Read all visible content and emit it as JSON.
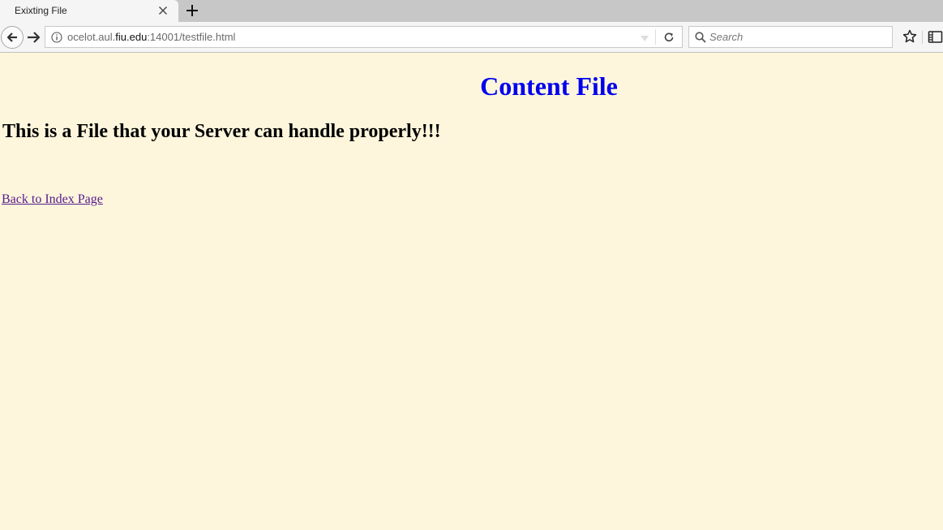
{
  "browser": {
    "tab": {
      "title": "Exixting File",
      "close_icon": "close-icon"
    },
    "new_tab_icon": "plus-icon",
    "nav": {
      "back_icon": "arrow-left-icon",
      "forward_icon": "arrow-right-icon",
      "reload_icon": "reload-icon",
      "info_icon": "info-icon"
    },
    "url": {
      "prefix": "ocelot.aul.",
      "domain": "fiu.edu",
      "suffix": ":14001/testfile.html"
    },
    "search": {
      "placeholder": "Search",
      "value": ""
    },
    "toolbar_icons": [
      "star-icon",
      "library-icon"
    ]
  },
  "page": {
    "heading": "Content File",
    "subheading": "This is a File that your Server can handle properly!!!",
    "back_link": "Back to Index Page",
    "colors": {
      "background": "#fdf6dc",
      "heading": "#0000ee",
      "visited_link": "#551a8b"
    }
  }
}
